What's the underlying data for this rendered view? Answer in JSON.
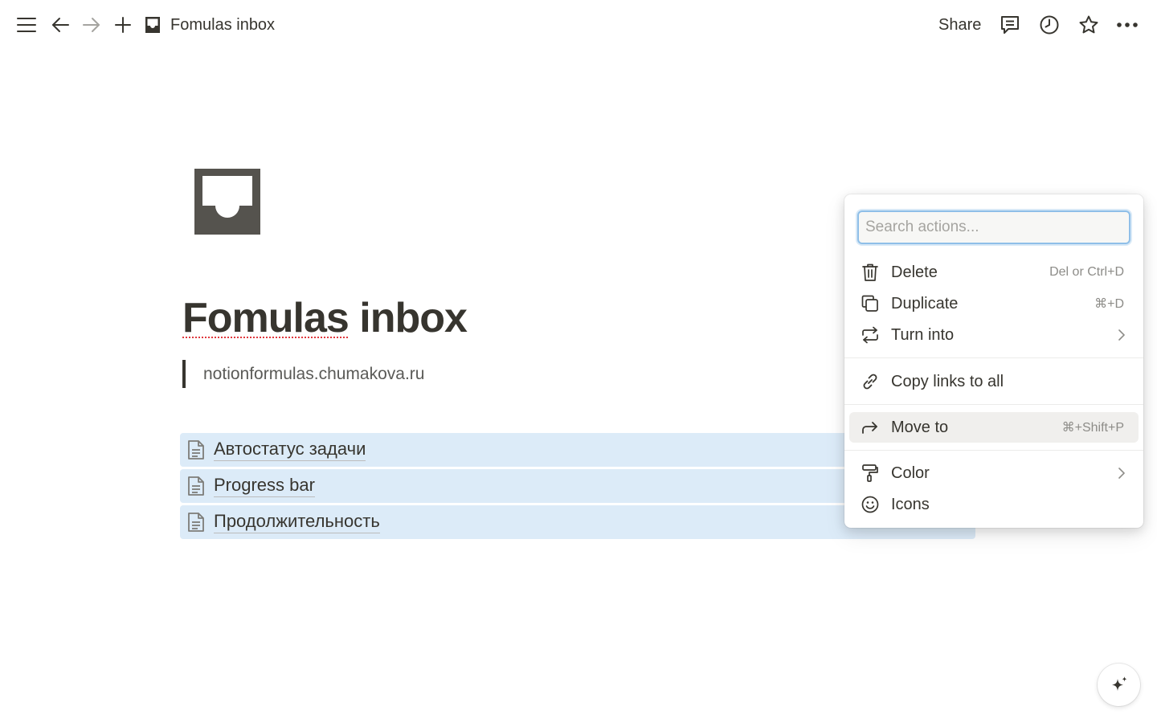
{
  "topbar": {
    "breadcrumb_title": "Fomulas inbox",
    "share_label": "Share",
    "icons": [
      "menu-icon",
      "back-arrow-icon",
      "forward-arrow-icon",
      "plus-icon",
      "inbox-icon",
      "comment-icon",
      "history-icon",
      "star-icon",
      "more-icon"
    ]
  },
  "page": {
    "title_typo": "Fomulas",
    "title_rest": " inbox",
    "quote": "notionformulas.chumakova.ru",
    "subpages": [
      {
        "label": "Автостатус задачи"
      },
      {
        "label": "Progress bar"
      },
      {
        "label": "Продолжительность"
      }
    ]
  },
  "menu": {
    "search_placeholder": "Search actions...",
    "items": [
      {
        "label": "Delete",
        "shortcut": "Del or Ctrl+D",
        "icon": "trash-icon"
      },
      {
        "label": "Duplicate",
        "shortcut": "⌘+D",
        "icon": "duplicate-icon"
      },
      {
        "label": "Turn into",
        "shortcut": "",
        "icon": "turn-into-icon",
        "submenu": true
      },
      {
        "label": "Copy links to all",
        "shortcut": "",
        "icon": "link-icon"
      },
      {
        "label": "Move to",
        "shortcut": "⌘+Shift+P",
        "icon": "move-to-icon",
        "highlighted": true
      },
      {
        "label": "Color",
        "shortcut": "",
        "icon": "paint-roller-icon",
        "submenu": true
      },
      {
        "label": "Icons",
        "shortcut": "",
        "icon": "smiley-icon"
      }
    ]
  },
  "colors": {
    "text": "#37352f",
    "selection_bg": "#dcebf8",
    "focus_ring": "#8fbfe8",
    "hover_bg": "#f0efed",
    "muted": "#8d8c88"
  }
}
